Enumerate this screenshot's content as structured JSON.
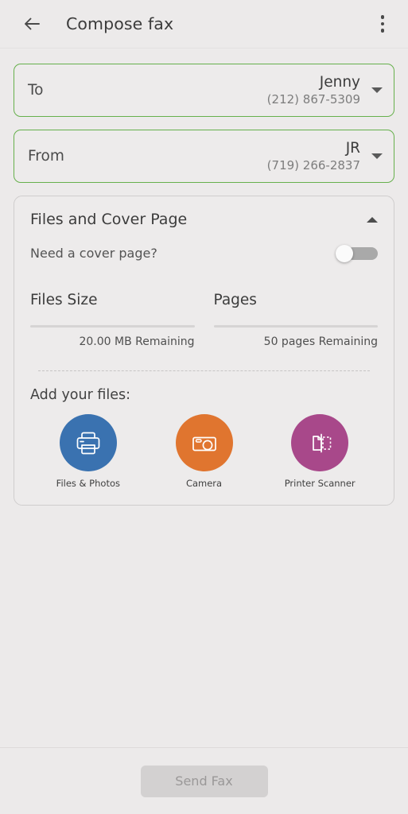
{
  "appbar": {
    "back_icon": "arrow-left-icon",
    "title": "Compose fax",
    "overflow_icon": "more-vertical-icon"
  },
  "recipients": [
    {
      "label": "To",
      "name": "Jenny",
      "number": "(212) 867-5309",
      "caret_icon": "chevron-down-icon"
    },
    {
      "label": "From",
      "name": "JR",
      "number": "(719) 266-2837",
      "caret_icon": "chevron-down-icon"
    }
  ],
  "card": {
    "title": "Files and Cover Page",
    "collapse_icon": "chevron-up-icon",
    "cover_page": {
      "label": "Need a cover page?",
      "toggle_state": "off"
    },
    "meters": [
      {
        "title": "Files Size",
        "caption": "20.00 MB Remaining",
        "progress": 0
      },
      {
        "title": "Pages",
        "caption": "50 pages Remaining",
        "progress": 0
      }
    ],
    "add_files_label": "Add your files:",
    "sources": [
      {
        "label": "Files & Photos",
        "icon": "printer-icon",
        "color": "#3a72b0"
      },
      {
        "label": "Camera",
        "icon": "camera-icon",
        "color": "#e0752f"
      },
      {
        "label": "Printer Scanner",
        "icon": "scanner-icon",
        "color": "#a8488a"
      }
    ]
  },
  "bottombar": {
    "send_label": "Send Fax"
  },
  "colors": {
    "field_border_green": "#66b04c",
    "background": "#eceaea",
    "text_primary": "#3c3c3c",
    "text_secondary": "#7d7d7d"
  }
}
